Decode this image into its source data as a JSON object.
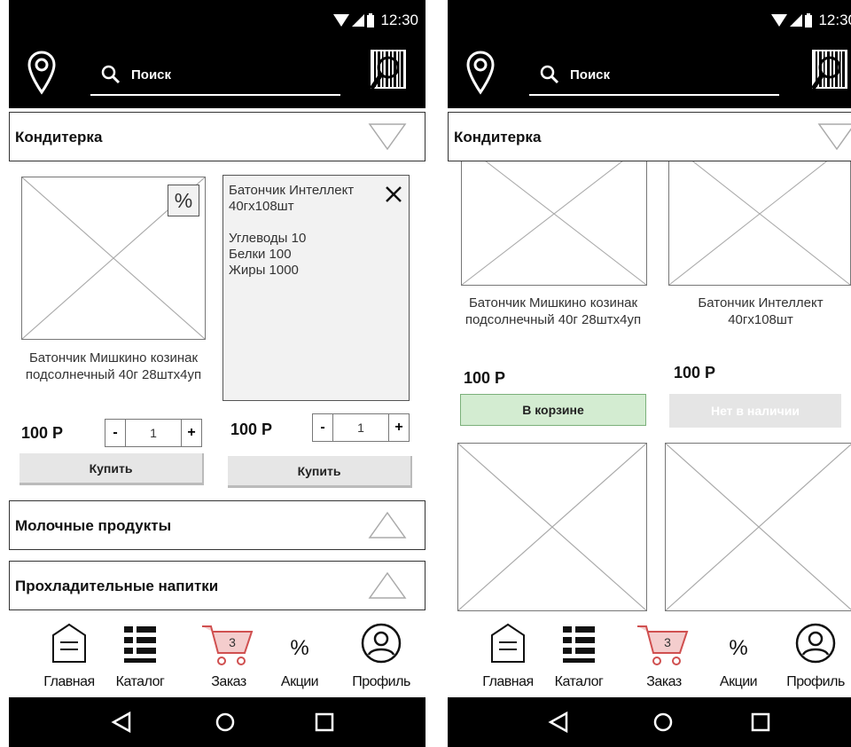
{
  "status": {
    "time": "12:30"
  },
  "search": {
    "placeholder": "Поиск"
  },
  "colors": {
    "bar": "#000000",
    "in_cart": "#d3ecd1",
    "cart_icon": "#e07070",
    "out_of_stock": "#e5e5e5"
  },
  "icons": {
    "pin": "map-pin-icon",
    "search": "search-icon",
    "barcode": "barcode-scan-icon",
    "arrow_down": "triangle-down-icon",
    "arrow_up": "triangle-up-icon",
    "close": "close-icon",
    "home": "home-icon",
    "catalog": "list-icon",
    "cart": "cart-icon",
    "promo": "percent-icon",
    "profile": "profile-icon",
    "back": "back-triangle-icon",
    "circle": "home-circle-icon",
    "square": "recents-square-icon"
  },
  "left": {
    "categories": [
      "Кондитерка",
      "Молочные продукты",
      "Прохладительные напитки"
    ],
    "product1": {
      "badge": "%",
      "name": "Батончик Мишкино козинак подсолнечный 40г 28штх4уп",
      "price": "100 Р",
      "qty": "1",
      "minus": "-",
      "plus": "+",
      "buy": "Купить"
    },
    "product2": {
      "info": "Батончик Интеллект\n40гх108шт\n\nУглеводы 10\nБелки 100\nЖиры 1000",
      "price": "100 Р",
      "qty": "1",
      "minus": "-",
      "plus": "+",
      "buy": "Купить"
    }
  },
  "right": {
    "category": "Кондитерка",
    "product1": {
      "name": "Батончик Мишкино козинак подсолнечный 40г 28штх4уп",
      "price": "100 Р",
      "button": "В корзине"
    },
    "product2": {
      "name": "Батончик Интеллект 40гх108шт",
      "price": "100 Р",
      "button": "Нет в наличии"
    }
  },
  "tabs": [
    {
      "label": "Главная"
    },
    {
      "label": "Каталог"
    },
    {
      "label": "Заказ",
      "cart_count": "3"
    },
    {
      "label": "Акции",
      "glyph": "%"
    },
    {
      "label": "Профиль"
    }
  ]
}
